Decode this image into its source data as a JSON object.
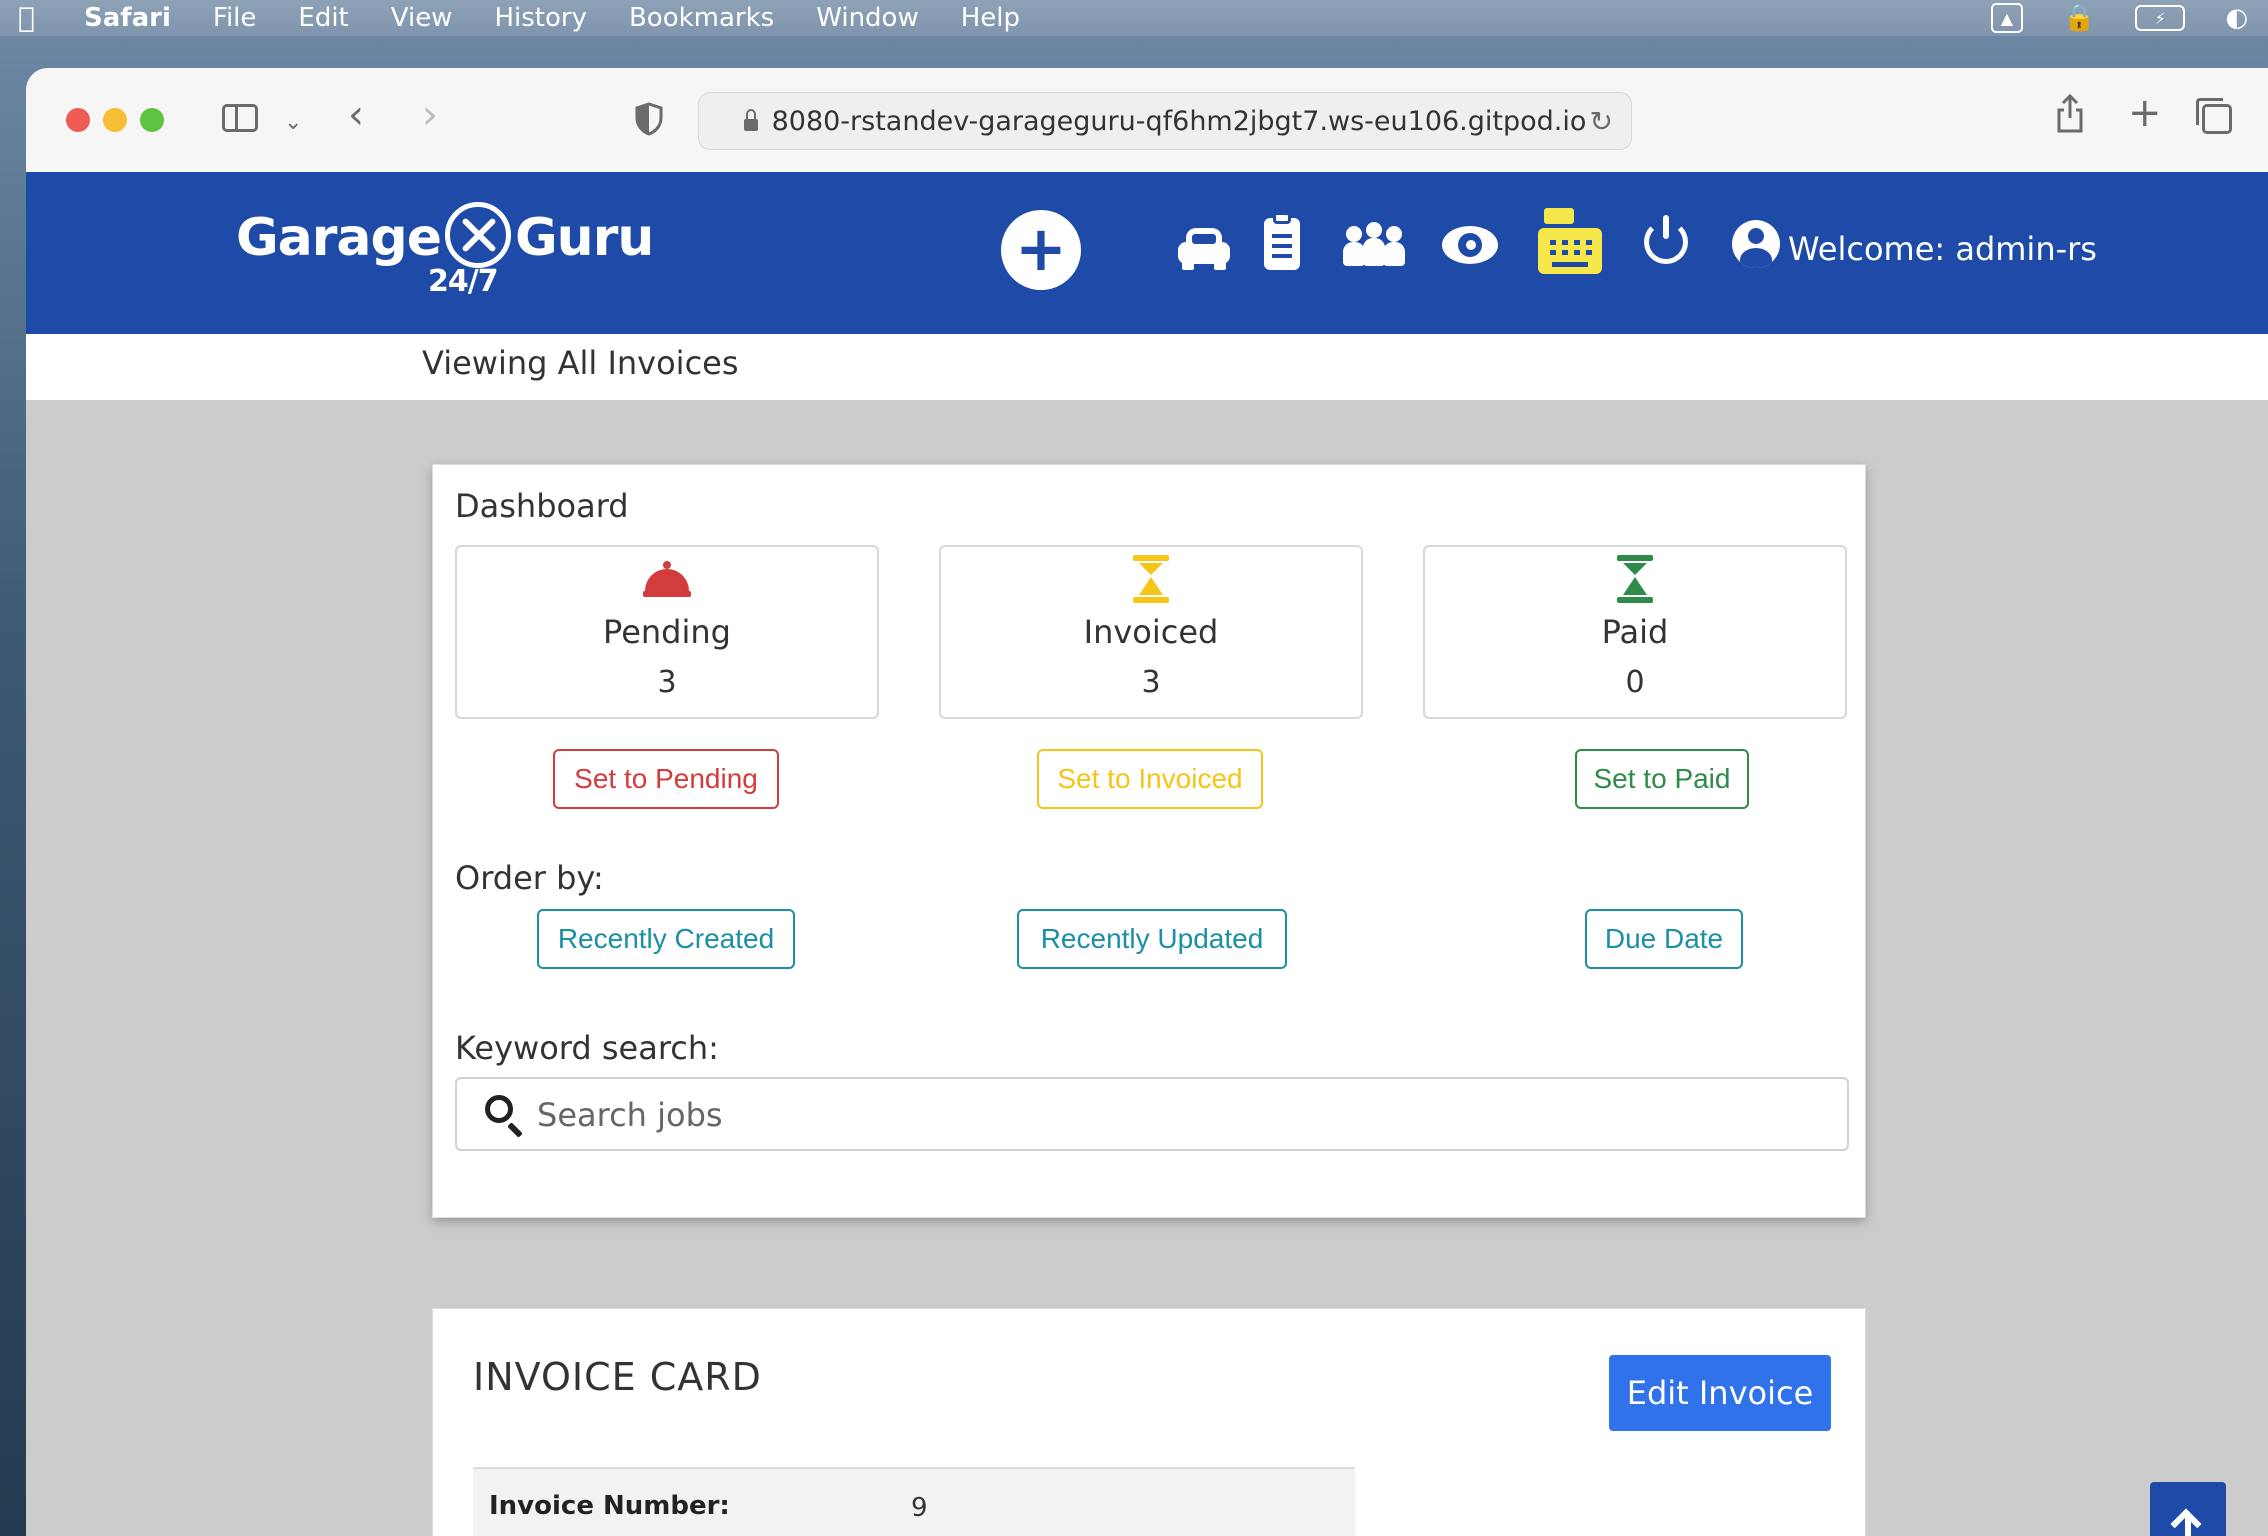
{
  "menubar": {
    "app": "Safari",
    "items": [
      "File",
      "Edit",
      "View",
      "History",
      "Bookmarks",
      "Window",
      "Help"
    ]
  },
  "browser": {
    "url": "8080-rstandev-garageguru-qf6hm2jbgt7.ws-eu106.gitpod.io"
  },
  "header": {
    "logo_text": "Garage",
    "logo_text2": "Guru",
    "logo_sub": "24/7",
    "welcome": "Welcome: admin-rs",
    "active_color": "#f6e84a",
    "bg_color": "#1e4aa8"
  },
  "page": {
    "title": "Viewing All Invoices"
  },
  "dashboard": {
    "title": "Dashboard",
    "stats": [
      {
        "label": "Pending",
        "value": "3",
        "color": "#d33c3c"
      },
      {
        "label": "Invoiced",
        "value": "3",
        "color": "#f5c518"
      },
      {
        "label": "Paid",
        "value": "0",
        "color": "#2e8b4a"
      }
    ],
    "set_buttons": [
      "Set to Pending",
      "Set to Invoiced",
      "Set to Paid"
    ],
    "order_label": "Order by:",
    "order_buttons": [
      "Recently Created",
      "Recently Updated",
      "Due Date"
    ],
    "search_label": "Keyword search:",
    "search_placeholder": "Search jobs"
  },
  "invoice_card": {
    "title": "INVOICE CARD",
    "edit_label": "Edit Invoice",
    "fields": [
      {
        "key": "Invoice Number:",
        "value": "9"
      }
    ]
  }
}
